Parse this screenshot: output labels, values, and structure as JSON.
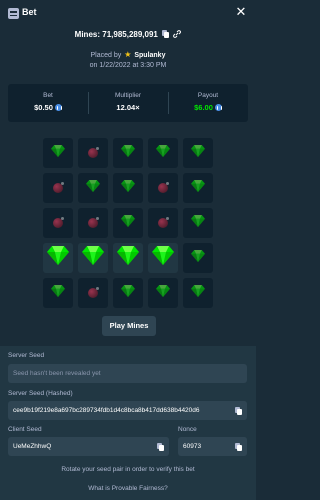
{
  "header": {
    "title": "Bet",
    "close_icon": "close-icon",
    "title_icon": "receipt-icon"
  },
  "bet_info": {
    "mines_prefix": "Mines:",
    "bet_id": "71,985,289,091",
    "placed_by_prefix": "Placed by",
    "user": "Spulanky",
    "date_line": "on 1/22/2022 at 3:30 PM"
  },
  "stats": {
    "bet_label": "Bet",
    "bet_value": "$0.50",
    "multiplier_label": "Multiplier",
    "multiplier_value": "12.04×",
    "payout_label": "Payout",
    "payout_value": "$6.00"
  },
  "grid": {
    "rows": 5,
    "cols": 5,
    "tiles": [
      "gem",
      "mine",
      "gem",
      "gem",
      "gem",
      "mine",
      "gem",
      "gem",
      "mine",
      "gem",
      "mine",
      "mine",
      "gem",
      "mine",
      "gem",
      "win",
      "win",
      "win",
      "win",
      "gem",
      "gem",
      "mine",
      "gem",
      "gem",
      "gem"
    ]
  },
  "play_button": {
    "label": "Play Mines"
  },
  "fairness": {
    "server_seed_label": "Server Seed",
    "server_seed_placeholder": "Seed hasn't been revealed yet",
    "server_seed_hashed_label": "Server Seed (Hashed)",
    "server_seed_hashed_value": "cee9b19f219e8a697bc289734fdb1d4c8bca8b417dd638b4420d6",
    "client_seed_label": "Client Seed",
    "client_seed_value": "UeMeZhhwQ",
    "nonce_label": "Nonce",
    "nonce_value": "60973",
    "rotate_text": "Rotate your seed pair in order to verify this bet",
    "what_is_link": "What is Provable Fairness?"
  },
  "colors": {
    "background": "#1a2c38",
    "panel": "#0f212e",
    "tile_revealed": "#213743",
    "gem_green": "#00e701",
    "mine_red": "#c73a5a",
    "muted_text": "#b1bad3"
  }
}
